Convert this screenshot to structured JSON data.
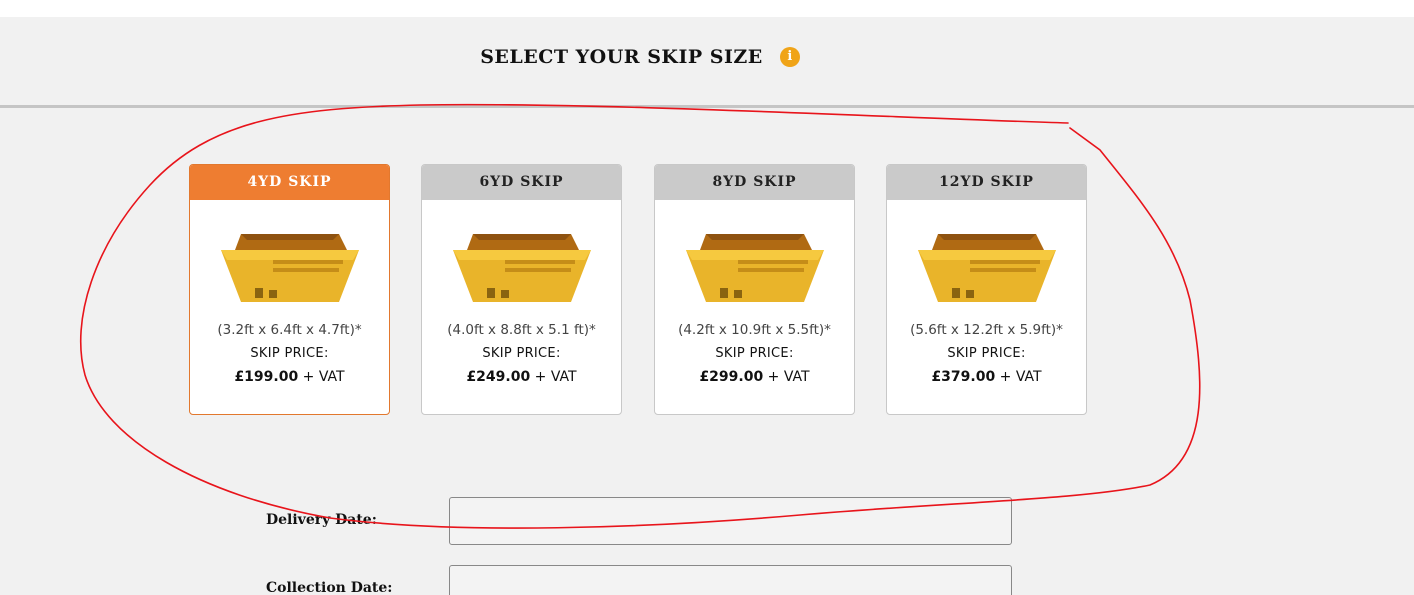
{
  "header": {
    "title": "SELECT YOUR SKIP SIZE",
    "info_icon": "info-icon",
    "info_glyph": "i"
  },
  "skips": [
    {
      "name": "4YD SKIP",
      "dims": "(3.2ft x 6.4ft x 4.7ft)*",
      "price_label": "SKIP PRICE:",
      "price": "£199.00",
      "vat": " + VAT",
      "selected": true
    },
    {
      "name": "6YD SKIP",
      "dims": "(4.0ft x 8.8ft x 5.1 ft)*",
      "price_label": "SKIP PRICE:",
      "price": "£249.00",
      "vat": " + VAT",
      "selected": false
    },
    {
      "name": "8YD SKIP",
      "dims": "(4.2ft x 10.9ft x 5.5ft)*",
      "price_label": "SKIP PRICE:",
      "price": "£299.00",
      "vat": " + VAT",
      "selected": false
    },
    {
      "name": "12YD SKIP",
      "dims": "(5.6ft x 12.2ft x 5.9ft)*",
      "price_label": "SKIP PRICE:",
      "price": "£379.00",
      "vat": " + VAT",
      "selected": false
    }
  ],
  "form": {
    "delivery_label": "Delivery Date:",
    "delivery_value": "",
    "collection_label": "Collection Date:",
    "collection_value": ""
  },
  "colors": {
    "selected_header": "#ee7d31",
    "unselected_header": "#cacaca",
    "info_icon": "#f0a418",
    "annotation_stroke": "#e8141b"
  }
}
